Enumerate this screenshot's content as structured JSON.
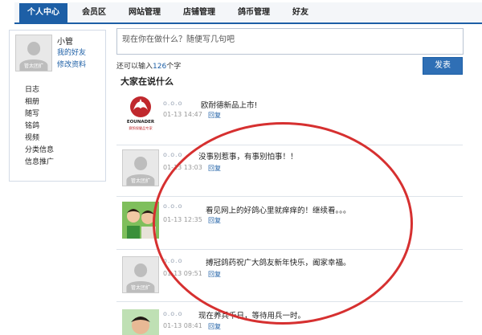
{
  "nav": {
    "tabs": [
      {
        "label": "个人中心"
      },
      {
        "label": "会员区"
      },
      {
        "label": "网站管理"
      },
      {
        "label": "店铺管理"
      },
      {
        "label": "鸽币管理"
      },
      {
        "label": "好友"
      }
    ]
  },
  "profile": {
    "username": "小管",
    "my_friends": "我的好友",
    "edit_profile": "修改资料",
    "avatar_watermark": "管太团扩"
  },
  "side_menu": [
    {
      "label": "日志"
    },
    {
      "label": "相册"
    },
    {
      "label": "随写"
    },
    {
      "label": "铭鸽"
    },
    {
      "label": "视频"
    },
    {
      "label": "分类信息"
    },
    {
      "label": "信息推广"
    }
  ],
  "composer": {
    "placeholder": "现在你在做什么？随便写几句吧",
    "counter_prefix": "还可以输入",
    "counter_value": "126",
    "counter_suffix": "个字",
    "submit_label": "发表"
  },
  "feed_title": "大家在说什么",
  "feed": [
    {
      "nick": "o.o.o",
      "text": "欧耐德新品上市!",
      "time": "01-13 14:47",
      "reply": "回复",
      "logo_text": "EOUNADER",
      "logo_sub": "赛鸽保健品专家"
    },
    {
      "nick": "o.o.o",
      "text": "没事别惹事，有事别怕事！！",
      "time": "01-13 13:03",
      "reply": "回复",
      "watermark": "管太团扩"
    },
    {
      "nick": "o.o.o",
      "text": "看见网上的好鸽心里就痒痒的！继续看。。。",
      "time": "01-13 12:35",
      "reply": "回复"
    },
    {
      "nick": "o.o.o",
      "text": "搏冠鸽药祝广大鸽友新年快乐，阖家幸福。",
      "time": "01-13 09:51",
      "reply": "回复",
      "watermark": "管太团扩"
    },
    {
      "nick": "o.o.o",
      "text": "现在养兵千日，等待用兵一时。",
      "time": "01-13 08:41",
      "reply": "回复"
    }
  ],
  "colors": {
    "nav_active": "#1d5fa6",
    "annotation_circle": "#d63030"
  }
}
